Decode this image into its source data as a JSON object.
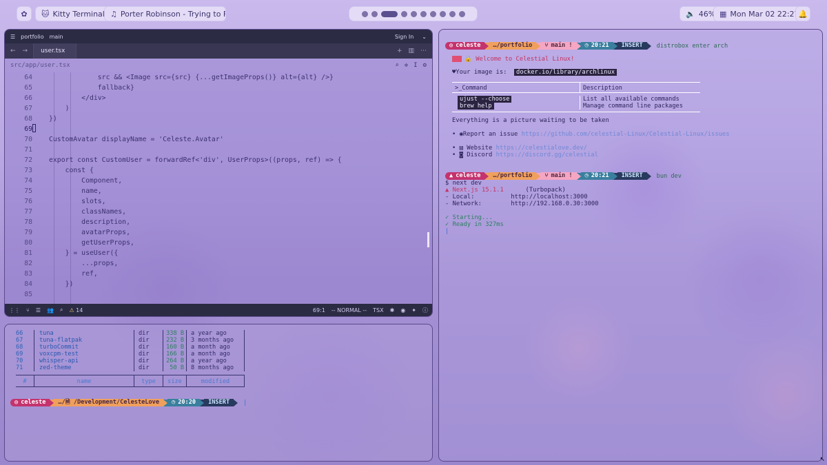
{
  "topbar": {
    "launcher_icon": "flower-icon",
    "app_name": "Kitty Terminal",
    "media_title": "Porter Robinson - Trying to Fe...",
    "battery": "46%",
    "datetime": "Mon Mar 02  22:27",
    "workspaces_count": 11,
    "active_workspace": 3,
    "colors": {
      "pill_bg": "#e4dcf7",
      "accent": "#5c4f8f"
    }
  },
  "editor": {
    "title_left": "portfolio",
    "branch": "main",
    "signin": "Sign In",
    "tab": "user.tsx",
    "path": "src/app/user.tsx",
    "status": {
      "warnings": "14",
      "position": "69:1",
      "mode": "-- NORMAL --",
      "lang": "TSX"
    },
    "lines": [
      {
        "n": "64",
        "t": "            src && <Image src={src} {...getImageProps()} alt={alt} />}"
      },
      {
        "n": "65",
        "t": "            fallback}"
      },
      {
        "n": "66",
        "t": "        </div>"
      },
      {
        "n": "67",
        "t": "    )"
      },
      {
        "n": "68",
        "t": "})"
      },
      {
        "n": "69",
        "t": ""
      },
      {
        "n": "70",
        "t": "CustomAvatar displayName = 'Celeste.Avatar'"
      },
      {
        "n": "71",
        "t": ""
      },
      {
        "n": "72",
        "t": "export const CustomUser = forwardRef<'div', UserProps>((props, ref) => {"
      },
      {
        "n": "73",
        "t": "    const {"
      },
      {
        "n": "74",
        "t": "        Component,"
      },
      {
        "n": "75",
        "t": "        name,"
      },
      {
        "n": "76",
        "t": "        slots,"
      },
      {
        "n": "77",
        "t": "        classNames,"
      },
      {
        "n": "78",
        "t": "        description,"
      },
      {
        "n": "79",
        "t": "        avatarProps,"
      },
      {
        "n": "80",
        "t": "        getUserProps,"
      },
      {
        "n": "81",
        "t": "    } = useUser({"
      },
      {
        "n": "82",
        "t": "        ...props,"
      },
      {
        "n": "83",
        "t": "        ref,"
      },
      {
        "n": "84",
        "t": "    })"
      },
      {
        "n": "85",
        "t": ""
      }
    ]
  },
  "filemanager": {
    "rows": [
      {
        "idx": "66",
        "name": "tuna",
        "type": "dir",
        "size": "338 B",
        "modified": "a year ago"
      },
      {
        "idx": "67",
        "name": "tuna-flatpak",
        "type": "dir",
        "size": "232 B",
        "modified": "3 months ago"
      },
      {
        "idx": "68",
        "name": "turboCommit",
        "type": "dir",
        "size": "160 B",
        "modified": "a month ago"
      },
      {
        "idx": "69",
        "name": "voxcpm-test",
        "type": "dir",
        "size": "166 B",
        "modified": "a month ago"
      },
      {
        "idx": "70",
        "name": "whisper-api",
        "type": "dir",
        "size": "264 B",
        "modified": "a year ago"
      },
      {
        "idx": "71",
        "name": "zed-theme",
        "type": "dir",
        "size": "50 B",
        "modified": "8 months ago"
      }
    ],
    "header": {
      "idx": "#",
      "name": "name",
      "type": "type",
      "size": "size",
      "modified": "modified"
    },
    "prompt": {
      "user": "celeste",
      "dir": "…/🗎 /Development/CelesteLove",
      "time": "20:20",
      "mode": "INSERT"
    }
  },
  "terminal": {
    "prompt1": {
      "user": "celeste",
      "dir": "…/portfolio",
      "git": "main !",
      "time": "20:21",
      "mode": "INSERT",
      "cmd": "distrobox enter arch"
    },
    "welcome": "Welcome to Celestial Linux!",
    "image_label": "Your image is:",
    "image_value": "docker.io/library/archlinux",
    "table_head_cmd": "Command",
    "table_head_desc": "Description",
    "table_rows": [
      {
        "cmd": "ujust --choose",
        "desc": "List all available commands"
      },
      {
        "cmd": "brew help",
        "desc": "Manage command line packages"
      }
    ],
    "picture": "Everything is a picture waiting to be taken",
    "links": [
      {
        "label": "Report an issue",
        "url": "https://github.com/celestial-Linux/Celestial-Linux/issues"
      },
      {
        "label": "Website",
        "url": "https://celestialove.dev/"
      },
      {
        "label": "Discord",
        "url": "https://discord.gg/celestial"
      }
    ],
    "prompt2": {
      "user": "celeste",
      "dir": "…/portfolio",
      "git": "main !",
      "time": "20:21",
      "mode": "INSERT",
      "cmd": "bun dev"
    },
    "next_cmd": "$ next dev",
    "next_ver": "▲ Next.js 15.1.1",
    "turbopack": "(Turbopack)",
    "local_label": "- Local:",
    "local_url": "http://localhost:3000",
    "network_label": "- Network:",
    "network_url": "http://192.168.0.30:3000",
    "starting": "✓ Starting...",
    "ready": "✓ Ready in 327ms",
    "cursor": "|"
  }
}
